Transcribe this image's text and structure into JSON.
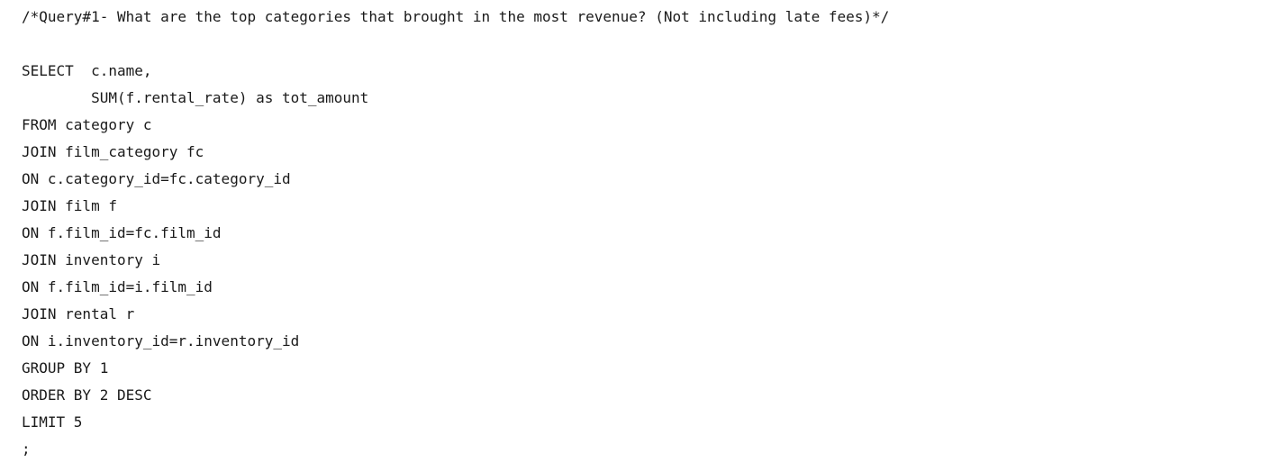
{
  "editor": {
    "lines": [
      "/*Query#1- What are the top categories that brought in the most revenue? (Not including late fees)*/",
      "",
      "SELECT  c.name,",
      "        SUM(f.rental_rate) as tot_amount",
      "FROM category c",
      "JOIN film_category fc",
      "ON c.category_id=fc.category_id",
      "JOIN film f",
      "ON f.film_id=fc.film_id",
      "JOIN inventory i",
      "ON f.film_id=i.film_id",
      "JOIN rental r",
      "ON i.inventory_id=r.inventory_id",
      "GROUP BY 1",
      "ORDER BY 2 DESC",
      "LIMIT 5",
      ";"
    ]
  }
}
